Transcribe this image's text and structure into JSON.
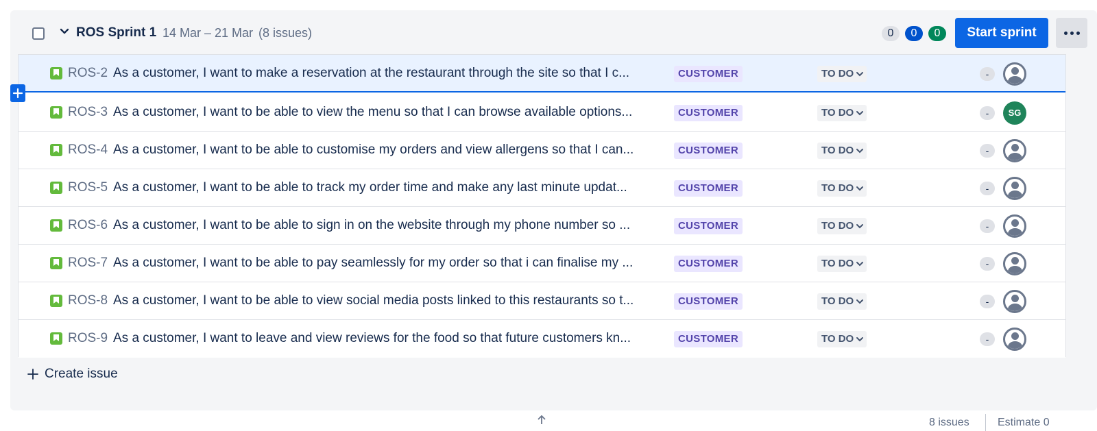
{
  "sprint": {
    "name": "ROS Sprint 1",
    "dates": "14 Mar – 21 Mar",
    "issue_count": "(8 issues)",
    "counts": {
      "todo": "0",
      "in_progress": "0",
      "done": "0"
    },
    "start_label": "Start sprint",
    "create_label": "Create issue"
  },
  "issues": [
    {
      "key": "ROS-2",
      "summary": "As a customer, I want to make a reservation at the restaurant through the site so that I c...",
      "label": "CUSTOMER",
      "status": "TO DO",
      "estimate": "-",
      "assignee": ""
    },
    {
      "key": "ROS-3",
      "summary": "As a customer, I want to be able to view the menu so that I can browse available options...",
      "label": "CUSTOMER",
      "status": "TO DO",
      "estimate": "-",
      "assignee": "SG"
    },
    {
      "key": "ROS-4",
      "summary": "As a customer, I want to be able to customise my orders and view allergens so that I can...",
      "label": "CUSTOMER",
      "status": "TO DO",
      "estimate": "-",
      "assignee": ""
    },
    {
      "key": "ROS-5",
      "summary": "As a customer, I want to be able to track my order time and make any last minute updat...",
      "label": "CUSTOMER",
      "status": "TO DO",
      "estimate": "-",
      "assignee": ""
    },
    {
      "key": "ROS-6",
      "summary": "As a customer, I want to be able to sign in on the website through my phone number so ...",
      "label": "CUSTOMER",
      "status": "TO DO",
      "estimate": "-",
      "assignee": ""
    },
    {
      "key": "ROS-7",
      "summary": "As a customer, I want to be able to pay seamlessly for my order so that i can finalise my ...",
      "label": "CUSTOMER",
      "status": "TO DO",
      "estimate": "-",
      "assignee": ""
    },
    {
      "key": "ROS-8",
      "summary": "As a customer, I want to be able to view social media posts linked to this restaurants so t...",
      "label": "CUSTOMER",
      "status": "TO DO",
      "estimate": "-",
      "assignee": ""
    },
    {
      "key": "ROS-9",
      "summary": "As a customer, I want to leave and view reviews for the food so that future customers kn...",
      "label": "CUSTOMER",
      "status": "TO DO",
      "estimate": "-",
      "assignee": ""
    }
  ],
  "footer": {
    "issues_text": "8 issues",
    "estimate_text": "Estimate 0"
  }
}
